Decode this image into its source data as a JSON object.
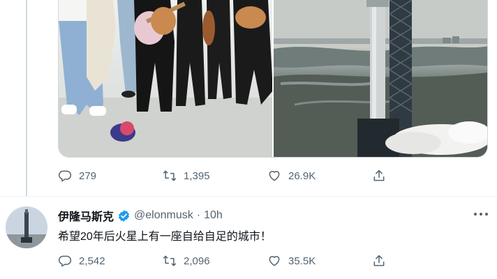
{
  "thread_tweet": {
    "stats": {
      "replies": "279",
      "retweets": "1,395",
      "likes": "26.9K"
    }
  },
  "main_tweet": {
    "author": {
      "display_name": "伊隆马斯克",
      "handle": "@elonmusk",
      "time": "10h",
      "separator": "·"
    },
    "text": "希望20年后火星上有一座自给自足的城市！",
    "stats": {
      "replies": "2,542",
      "retweets": "2,096",
      "likes": "35.5K"
    }
  },
  "icons": [
    "reply-icon",
    "retweet-icon",
    "like-icon",
    "share-icon",
    "verified-badge-icon",
    "more-icon"
  ],
  "colors": {
    "text_primary": "#0f1419",
    "text_secondary": "#536471",
    "verified_blue": "#1d9bf0",
    "thread_line": "#cfd9de"
  }
}
